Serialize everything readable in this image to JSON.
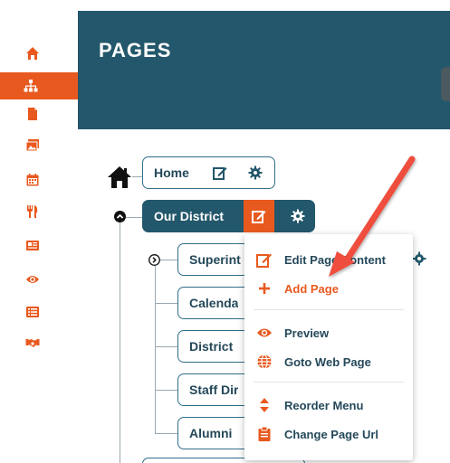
{
  "header": {
    "title": "PAGES"
  },
  "sidebar": {
    "items": [
      {
        "icon": "home-icon"
      },
      {
        "icon": "sitemap-icon",
        "active": true
      },
      {
        "icon": "file-icon"
      },
      {
        "icon": "image-gallery-icon"
      },
      {
        "icon": "calendar-icon"
      },
      {
        "icon": "utensils-icon"
      },
      {
        "icon": "news-card-icon"
      },
      {
        "icon": "eye-icon"
      },
      {
        "icon": "list-icon"
      },
      {
        "icon": "handshake-icon"
      }
    ]
  },
  "tree": {
    "root": {
      "label": "Home"
    },
    "selected": {
      "label": "Our District"
    },
    "children": [
      {
        "label": "Superint"
      },
      {
        "label": "Calenda"
      },
      {
        "label": "District"
      },
      {
        "label": "Staff Dir"
      },
      {
        "label": "Alumni"
      }
    ]
  },
  "context_menu": {
    "items": [
      {
        "label": "Edit Page Content",
        "icon": "edit-icon"
      },
      {
        "label": "Add Page",
        "icon": "plus-icon",
        "highlighted": true
      },
      {
        "label": "Preview",
        "icon": "eye-icon"
      },
      {
        "label": "Goto Web Page",
        "icon": "globe-icon"
      },
      {
        "label": "Reorder Menu",
        "icon": "sort-icon"
      },
      {
        "label": "Change Page Url",
        "icon": "clipboard-icon"
      }
    ]
  },
  "colors": {
    "accent": "#e8591f",
    "header_bg": "#23576b",
    "node_border": "#2f6f8a",
    "annotation_arrow": "#ef4d3c"
  }
}
